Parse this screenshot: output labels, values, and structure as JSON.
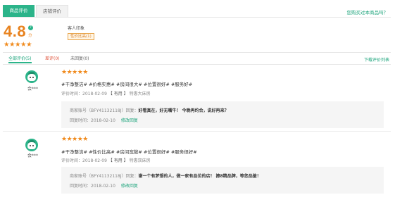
{
  "tabs": {
    "main": "商品评价",
    "second": "店铺评价"
  },
  "header_link": "您购买过本商品吗？",
  "summary": {
    "score": "4.8",
    "score_help": "?",
    "score_unit": "分",
    "rating": 5,
    "stars": "★★★★★",
    "impression_title": "客人印象",
    "impression_tag": "性价比高(1)"
  },
  "filters": {
    "all": "全部评价(5)",
    "bad": "差评(0)",
    "unreplied": "未回复(0)",
    "download": "下载评价列表"
  },
  "reviews": [
    {
      "user": "会***",
      "rating": 5,
      "stars": "★★★★★",
      "tags": "#干净整洁# #价格实惠# #房间很大# #位置很好# #服务好#",
      "time_label": "评价时间：",
      "time": "2018-02-09",
      "helpful": "【 有用 】",
      "room": "特惠大床房",
      "reply_label": "商家账号（BFY41132118J）回复：",
      "reply": "好看真在，好无嘴牛！ 今晚再约合，说好再来？",
      "reply_time_label": "回复时间：",
      "reply_time": "2018-02-10",
      "edit": "修改回复"
    },
    {
      "user": "会***",
      "rating": 5,
      "stars": "★★★★★",
      "tags": "#干净整洁# #性价比高# #房间宽敞# #位置很好# #服务很好#",
      "time_label": "评价时间：",
      "time": "2018-02-09",
      "helpful": "【 有用 】",
      "room": "特惠双床房",
      "reply_label": "商家账号（BFY41132118J）回复：",
      "reply": "谢一个有梦想的人，做一家有品位的店！ 擦8精品牌，等您品鉴！",
      "reply_time_label": "回复时间：",
      "reply_time": "2018-02-10",
      "edit": "修改回复"
    }
  ],
  "colors": {
    "accent": "#2cb48a",
    "score": "#e8821e",
    "star": "#f08a1c",
    "bad": "#e0533a"
  }
}
